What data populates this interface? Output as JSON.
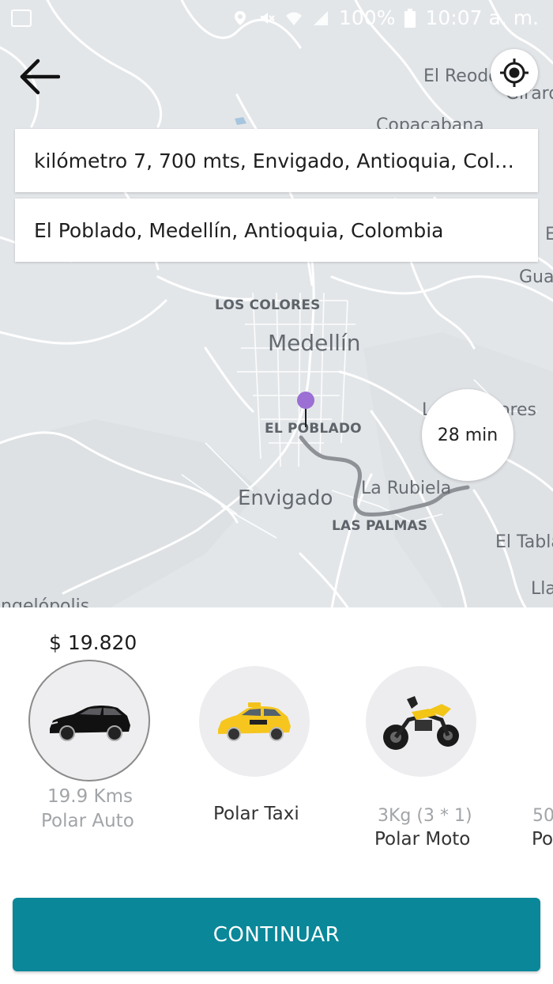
{
  "status_bar": {
    "battery": "100%",
    "time": "10:07 a. m."
  },
  "search": {
    "origin": "kilómetro 7, 700 mts, Envigado, Antioquia, Colo...",
    "destination": "El Poblado, Medellín, Antioquia, Colombia"
  },
  "map": {
    "labels": {
      "el_reodo": "El Reodo",
      "girard": "Girard",
      "copacabana": "Copacabana",
      "guarne": "Gua",
      "los_colores": "LOS COLORES",
      "medellin": "Medellín",
      "el_poblado": "EL POBLADO",
      "llanogrande_top": "L",
      "rionegro_fragment": "ores",
      "envigado": "Envigado",
      "la_rubiela": "La Rubiela",
      "las_palmas": "LAS PALMAS",
      "el_tablazo": "El Tabla",
      "llanogrande": "Lla",
      "angelopolis": "Angelópolis",
      "edge_e": "E"
    },
    "eta": "28 min",
    "pin_color": "#9b6fd4",
    "route_color": "#8e9296"
  },
  "vehicles": [
    {
      "id": "auto",
      "price": "$ 19.820",
      "sub": "19.9 Kms",
      "name": "Polar Auto",
      "selected": true,
      "icon": "car-icon"
    },
    {
      "id": "taxi",
      "price": "",
      "sub": "",
      "name": "Polar Taxi",
      "selected": false,
      "icon": "taxi-icon"
    },
    {
      "id": "moto",
      "price": "",
      "sub": "3Kg (3 * 1)",
      "name": "Polar Moto",
      "selected": false,
      "icon": "motorcycle-icon"
    },
    {
      "id": "partial",
      "price": "",
      "sub": "50",
      "name": "Po",
      "selected": false,
      "icon": "vehicle-icon"
    }
  ],
  "actions": {
    "continue_label": "CONTINUAR"
  },
  "colors": {
    "accent": "#0a8799",
    "map_bg": "#e3e6e9"
  }
}
